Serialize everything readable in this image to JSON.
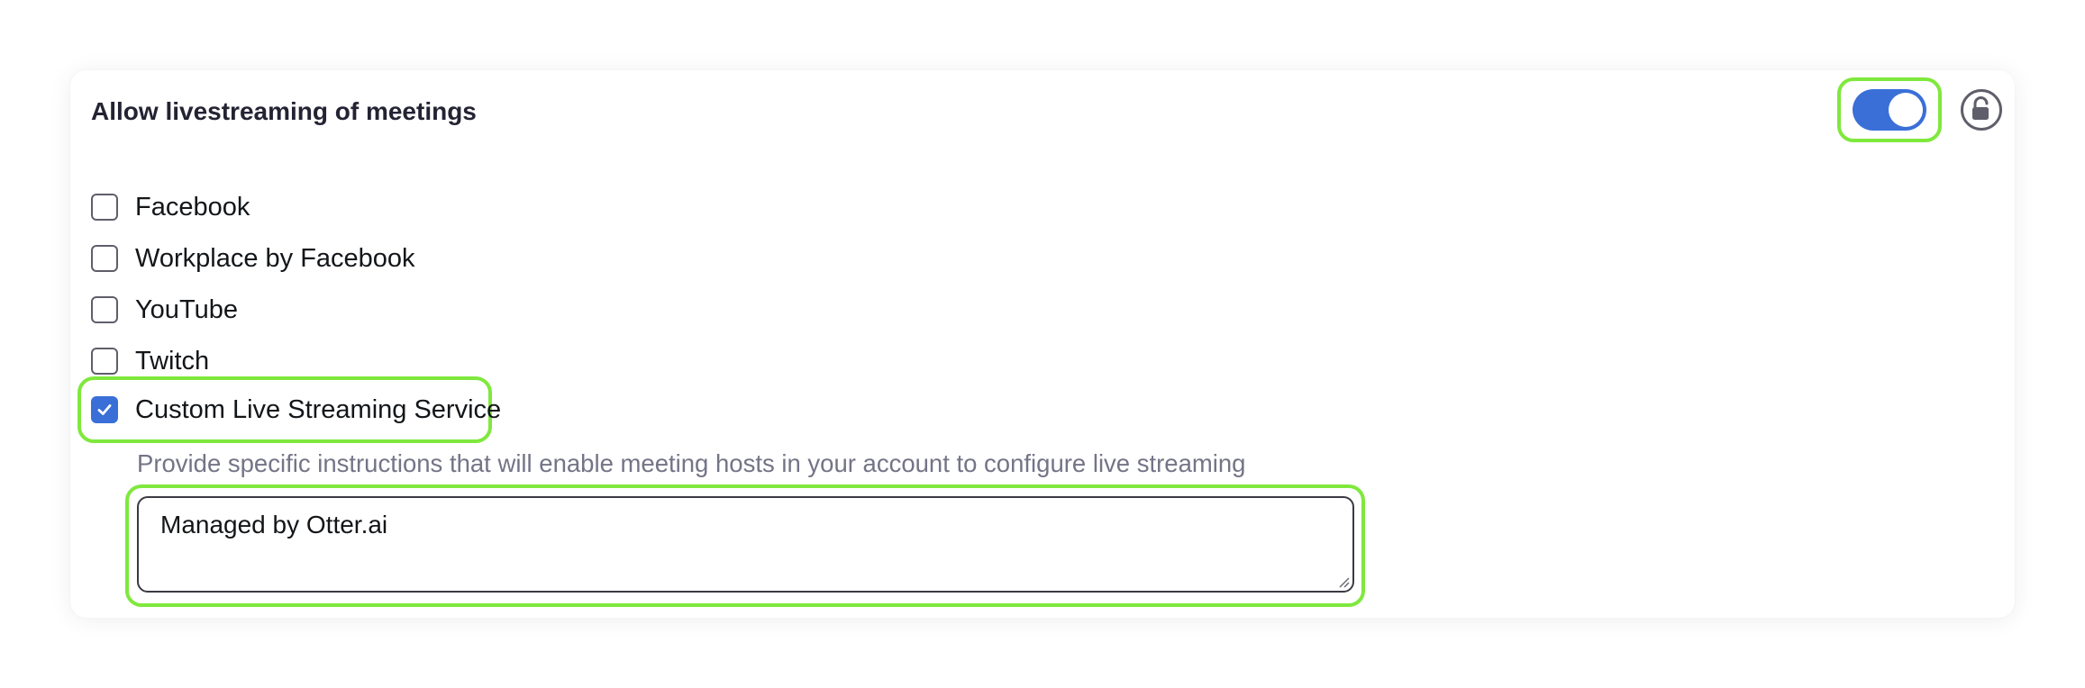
{
  "setting": {
    "title": "Allow livestreaming of meetings",
    "enabled": true,
    "lock_icon": "unlock-icon"
  },
  "options": [
    {
      "label": "Facebook",
      "checked": false
    },
    {
      "label": "Workplace by Facebook",
      "checked": false
    },
    {
      "label": "YouTube",
      "checked": false
    },
    {
      "label": "Twitch",
      "checked": false
    },
    {
      "label": "Custom Live Streaming Service",
      "checked": true
    }
  ],
  "custom_service": {
    "help_text": "Provide specific instructions that will enable meeting hosts in your account to configure live streaming",
    "instructions_value": "Managed by Otter.ai"
  },
  "colors": {
    "accent": "#3a6fd8",
    "highlight": "#7fe83d"
  }
}
